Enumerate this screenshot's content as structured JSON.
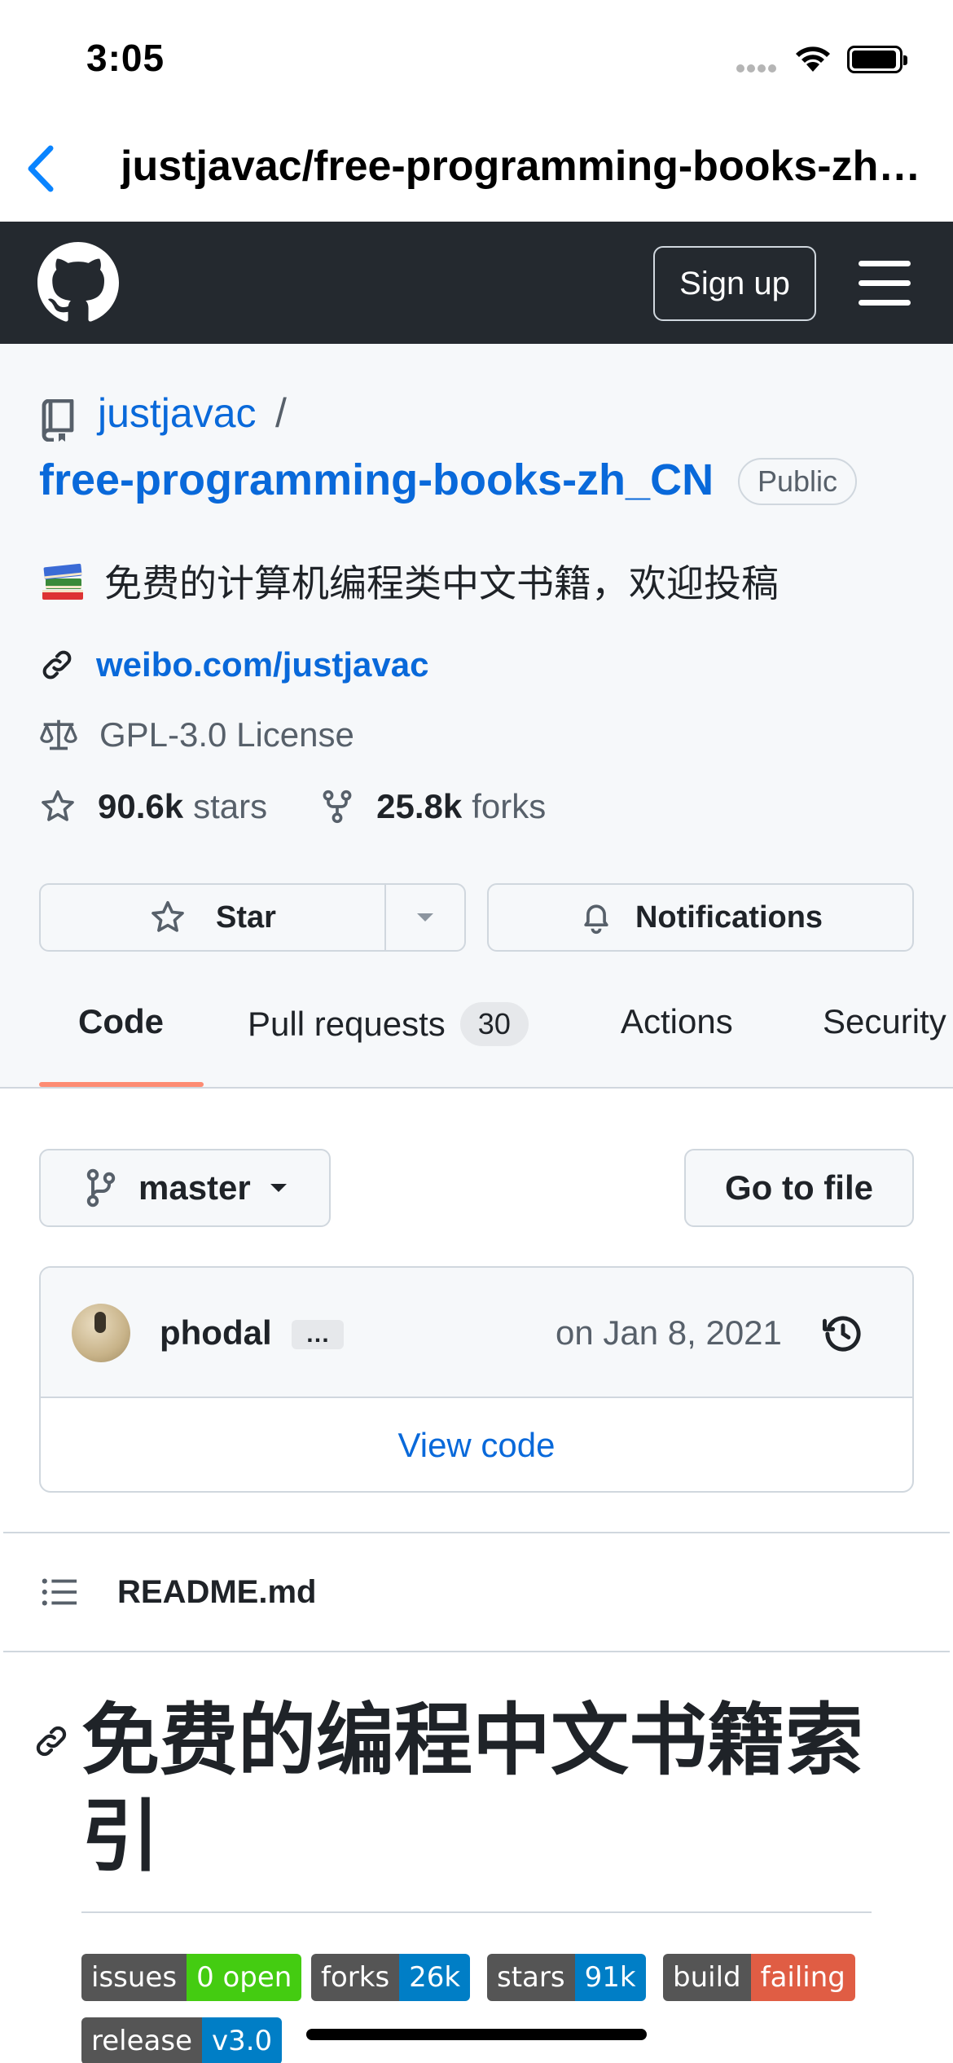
{
  "status_bar": {
    "time": "3:05"
  },
  "browser": {
    "title": "justjavac/free-programming-books-zh_CN"
  },
  "header": {
    "signup_label": "Sign up"
  },
  "repo": {
    "owner": "justjavac",
    "separator": "/",
    "name": "free-programming-books-zh_CN",
    "visibility": "Public",
    "description": "免费的计算机编程类中文书籍，欢迎投稿",
    "website": "weibo.com/justjavac",
    "license": "GPL-3.0 License",
    "stars_count": "90.6k",
    "stars_label": "stars",
    "forks_count": "25.8k",
    "forks_label": "forks"
  },
  "actions": {
    "star_label": "Star",
    "notifications_label": "Notifications"
  },
  "tabs": [
    {
      "label": "Code"
    },
    {
      "label": "Pull requests",
      "badge": "30"
    },
    {
      "label": "Actions"
    },
    {
      "label": "Security"
    }
  ],
  "branch": {
    "name": "master",
    "go_to_file_label": "Go to file"
  },
  "commit": {
    "author": "phodal",
    "ellipsis": "…",
    "date": "on Jan 8, 2021",
    "view_code_label": "View code"
  },
  "readme": {
    "filename": "README.md",
    "heading": "免费的编程中文书籍索引",
    "badges": [
      {
        "left": "issues",
        "right": "0 open",
        "color": "#4c1"
      },
      {
        "left": "forks",
        "right": "26k",
        "color": "#007ec6"
      },
      {
        "left": "stars",
        "right": "91k",
        "color": "#007ec6"
      },
      {
        "left": "build",
        "right": "failing",
        "color": "#e05d44"
      },
      {
        "left": "release",
        "right": "v3.0",
        "color": "#007ec6"
      }
    ]
  },
  "colors": {
    "link": "#0969da",
    "header_bg": "#24292f",
    "tab_underline": "#fd8c73"
  }
}
